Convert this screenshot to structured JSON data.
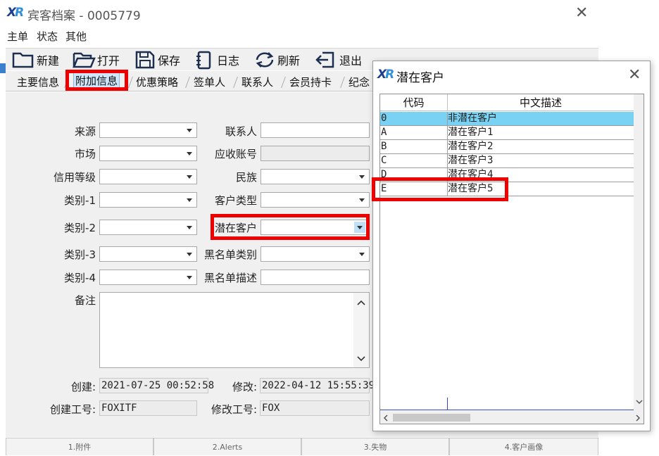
{
  "main_window": {
    "title": "宾客档案 - 0005779",
    "close_glyph": "✕"
  },
  "menu": {
    "items": [
      "主单",
      "状态",
      "其他"
    ]
  },
  "toolbar": {
    "new_label": "新建",
    "open_label": "打开",
    "save_label": "保存",
    "log_label": "日志",
    "refresh_label": "刷新",
    "exit_label": "退出"
  },
  "tabs": {
    "items": [
      "主要信息",
      "附加信息",
      "优惠策略",
      "签单人",
      "联系人",
      "会员持卡",
      "纪念"
    ],
    "active_index": 1
  },
  "form": {
    "source_label": "来源",
    "market_label": "市场",
    "credit_label": "信用等级",
    "cat1_label": "类别-1",
    "cat2_label": "类别-2",
    "cat3_label": "类别-3",
    "cat4_label": "类别-4",
    "remark_label": "备注",
    "contact_label": "联系人",
    "receivable_label": "应收账号",
    "ethnic_label": "民族",
    "customer_type_label": "客户类型",
    "potential_label": "潜在客户",
    "blacklist_type_label": "黑名单类别",
    "blacklist_desc_label": "黑名单描述",
    "created_label": "创建:",
    "created_value": "2021-07-25 00:52:58",
    "modified_label": "修改:",
    "modified_value": "2022-04-12 15:55:39",
    "creator_label": "创建工号:",
    "creator_value": "FOXITF",
    "modifier_label": "修改工号:",
    "modifier_value": "FOX"
  },
  "status_tabs": [
    "1.附件",
    "2.Alerts",
    "3.失物",
    "4.客户画像"
  ],
  "popup": {
    "title": "潜在客户",
    "close_glyph": "✕",
    "columns": [
      "代码",
      "中文描述"
    ],
    "rows": [
      {
        "code": "0",
        "desc": "非潜在客户"
      },
      {
        "code": "A",
        "desc": "潜在客户1"
      },
      {
        "code": "B",
        "desc": "潜在客户2"
      },
      {
        "code": "C",
        "desc": "潜在客户3"
      },
      {
        "code": "D",
        "desc": "潜在客户4"
      },
      {
        "code": "E",
        "desc": "潜在客户5"
      }
    ],
    "selected_index": 0,
    "selected_color": "#79d2f4"
  },
  "colors": {
    "highlight_red": "#ee0000",
    "window_bg": "#f0f0f0",
    "logo_dark": "#1b3f8f",
    "logo_light": "#2f8fd8"
  }
}
